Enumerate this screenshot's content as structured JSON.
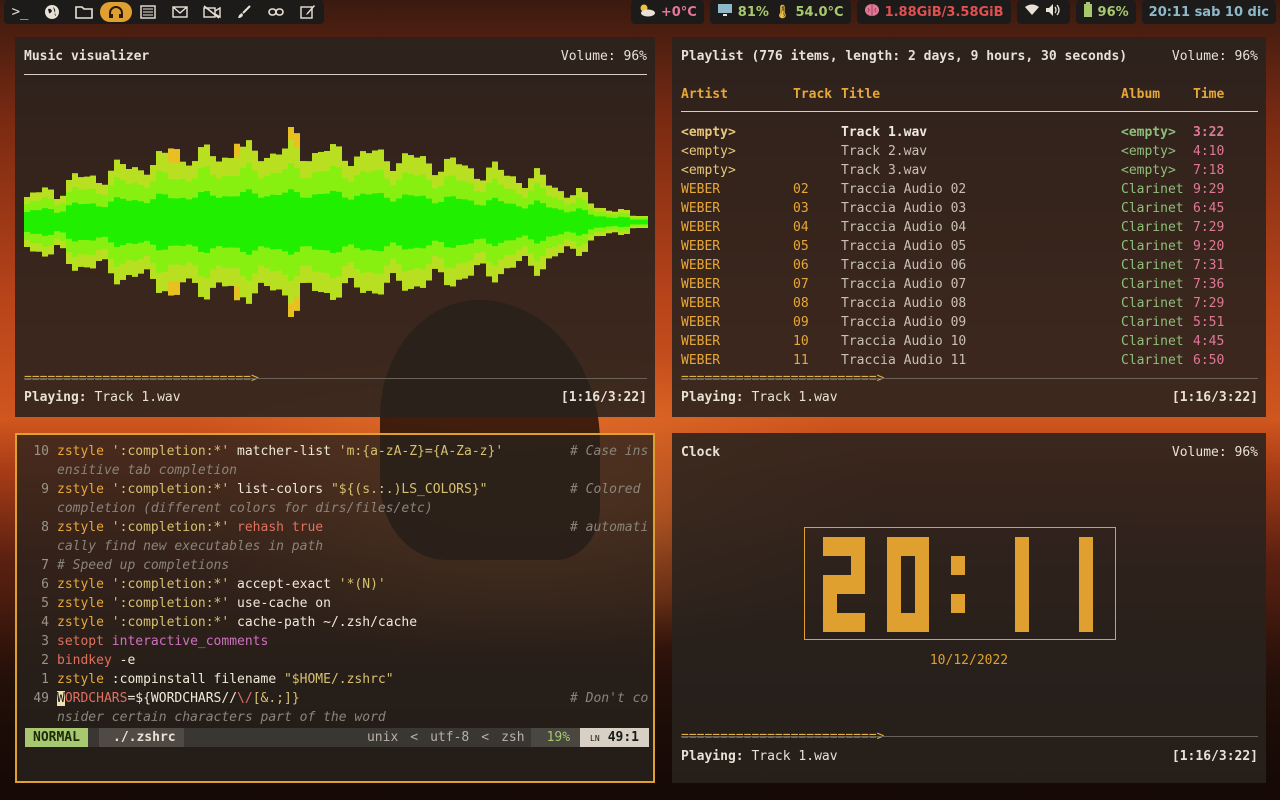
{
  "topbar": {
    "icons": [
      "terminal-icon",
      "globe-icon",
      "folder-icon",
      "headphones-icon",
      "newspaper-icon",
      "mail-icon",
      "camera-off-icon",
      "brush-icon",
      "link-icon",
      "edit-icon"
    ],
    "weather": "+0°C",
    "cpu": "81%",
    "temp": "54.0°C",
    "memory": "1.88GiB/3.58GiB",
    "battery": "96%",
    "datetime": "20:11 sab 10 dic",
    "colors": {
      "accent": "#e0a030",
      "cpu": "#a8c870",
      "memory": "#e05050",
      "battery": "#a8c870",
      "date": "#8fb8c8"
    }
  },
  "visualizer": {
    "title": "Music visualizer",
    "volume": "Volume: 96%",
    "progress": "=============================>",
    "playing_label": "Playing:",
    "playing_track": "Track 1.wav",
    "time": "[1:16/3:22]"
  },
  "playlist": {
    "title": "Playlist (776 items, length: 2 days, 9 hours, 30 seconds)",
    "volume": "Volume: 96%",
    "headers": {
      "artist": "Artist",
      "track": "Track",
      "title": "Title",
      "album": "Album",
      "time": "Time"
    },
    "rows": [
      {
        "artist": "<empty>",
        "track": "",
        "title": "Track 1.wav",
        "album": "<empty>",
        "time": "3:22"
      },
      {
        "artist": "<empty>",
        "track": "",
        "title": "Track 2.wav",
        "album": "<empty>",
        "time": "4:10"
      },
      {
        "artist": "<empty>",
        "track": "",
        "title": "Track 3.wav",
        "album": "<empty>",
        "time": "7:18"
      },
      {
        "artist": "WEBER",
        "track": "02",
        "title": "Traccia Audio 02",
        "album": "Clarinet",
        "time": "9:29"
      },
      {
        "artist": "WEBER",
        "track": "03",
        "title": "Traccia Audio 03",
        "album": "Clarinet",
        "time": "6:45"
      },
      {
        "artist": "WEBER",
        "track": "04",
        "title": "Traccia Audio 04",
        "album": "Clarinet",
        "time": "7:29"
      },
      {
        "artist": "WEBER",
        "track": "05",
        "title": "Traccia Audio 05",
        "album": "Clarinet",
        "time": "9:20"
      },
      {
        "artist": "WEBER",
        "track": "06",
        "title": "Traccia Audio 06",
        "album": "Clarinet",
        "time": "7:31"
      },
      {
        "artist": "WEBER",
        "track": "07",
        "title": "Traccia Audio 07",
        "album": "Clarinet",
        "time": "7:36"
      },
      {
        "artist": "WEBER",
        "track": "08",
        "title": "Traccia Audio 08",
        "album": "Clarinet",
        "time": "7:29"
      },
      {
        "artist": "WEBER",
        "track": "09",
        "title": "Traccia Audio 09",
        "album": "Clarinet",
        "time": "5:51"
      },
      {
        "artist": "WEBER",
        "track": "10",
        "title": "Traccia Audio 10",
        "album": "Clarinet",
        "time": "4:45"
      },
      {
        "artist": "WEBER",
        "track": "11",
        "title": "Traccia Audio 11",
        "album": "Clarinet",
        "time": "6:50"
      }
    ],
    "progress": "=========================>",
    "playing_label": "Playing:",
    "playing_track": "Track 1.wav",
    "time": "[1:16/3:22]"
  },
  "editor": {
    "lines": [
      {
        "n": "10",
        "parts": [
          [
            "zstyle ",
            "k-opt"
          ],
          [
            "':completion:*' ",
            "k-str"
          ],
          [
            "matcher-list ",
            "k-cmd"
          ],
          [
            "'m:{a-zA-Z}={A-Za-z}'",
            "k-str"
          ]
        ],
        "comment": "# Case ins"
      },
      {
        "n": "",
        "parts": [
          [
            "ensitive tab completion",
            "k-com"
          ]
        ],
        "comment": ""
      },
      {
        "n": "9",
        "parts": [
          [
            "zstyle ",
            "k-opt"
          ],
          [
            "':completion:*' ",
            "k-str"
          ],
          [
            "list-colors ",
            "k-cmd"
          ],
          [
            "\"${(s.:.)LS_COLORS}\"",
            "k-str"
          ]
        ],
        "comment": "# Colored "
      },
      {
        "n": "",
        "parts": [
          [
            "completion (different colors for dirs/files/etc)",
            "k-com"
          ]
        ],
        "comment": ""
      },
      {
        "n": "8",
        "parts": [
          [
            "zstyle ",
            "k-opt"
          ],
          [
            "':completion:*' ",
            "k-str"
          ],
          [
            "rehash ",
            "k-red"
          ],
          [
            "true",
            "k-red"
          ]
        ],
        "comment": "# automati"
      },
      {
        "n": "",
        "parts": [
          [
            "cally find new executables in path",
            "k-com"
          ]
        ],
        "comment": ""
      },
      {
        "n": "7",
        "parts": [
          [
            "# Speed up completions",
            "k-com"
          ]
        ],
        "comment": ""
      },
      {
        "n": "6",
        "parts": [
          [
            "zstyle ",
            "k-opt"
          ],
          [
            "':completion:*' ",
            "k-str"
          ],
          [
            "accept-exact ",
            "k-cmd"
          ],
          [
            "'*(N)'",
            "k-str"
          ]
        ],
        "comment": ""
      },
      {
        "n": "5",
        "parts": [
          [
            "zstyle ",
            "k-opt"
          ],
          [
            "':completion:*' ",
            "k-str"
          ],
          [
            "use-cache on",
            "k-cmd"
          ]
        ],
        "comment": ""
      },
      {
        "n": "4",
        "parts": [
          [
            "zstyle ",
            "k-opt"
          ],
          [
            "':completion:*' ",
            "k-str"
          ],
          [
            "cache-path ~/.zsh/cache",
            "k-cmd"
          ]
        ],
        "comment": ""
      },
      {
        "n": "3",
        "parts": [
          [
            "setopt ",
            "k-red"
          ],
          [
            "interactive_comments",
            "k-mag"
          ]
        ],
        "comment": ""
      },
      {
        "n": "2",
        "parts": [
          [
            "bindkey ",
            "k-red"
          ],
          [
            "-e",
            "k-cmd"
          ]
        ],
        "comment": ""
      },
      {
        "n": "1",
        "parts": [
          [
            "zstyle ",
            "k-opt"
          ],
          [
            ":compinstall filename ",
            "k-cmd"
          ],
          [
            "\"$HOME/.zshrc\"",
            "k-str"
          ]
        ],
        "comment": ""
      },
      {
        "n": "49",
        "parts": [
          [
            "W",
            "cursor"
          ],
          [
            "ORDCHARS",
            "k-var"
          ],
          [
            "=${WORDCHARS//",
            "k-cmd"
          ],
          [
            "\\/",
            "k-red"
          ],
          [
            "[&.;]}",
            "k-str"
          ]
        ],
        "comment": "# Don't co"
      },
      {
        "n": "",
        "parts": [
          [
            "nsider certain characters part of the word",
            "k-com"
          ]
        ],
        "comment": ""
      }
    ],
    "status": {
      "mode": "NORMAL",
      "file": "./.zshrc",
      "format": "unix",
      "encoding": "utf-8",
      "filetype": "zsh",
      "percent": "19%",
      "ln_label": "LN",
      "position": "49:1"
    }
  },
  "clock": {
    "title": "Clock",
    "volume": "Volume: 96%",
    "time": "20:11",
    "date": "10/12/2022",
    "progress": "=========================>",
    "playing_label": "Playing:",
    "playing_track": "Track 1.wav",
    "play_time": "[1:16/3:22]"
  }
}
